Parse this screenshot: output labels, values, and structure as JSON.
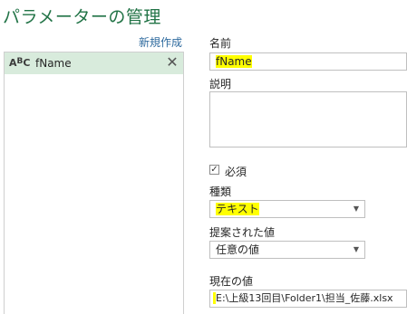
{
  "title": "パラメーターの管理",
  "new_link": "新規作成",
  "parameter_list": [
    {
      "name": "fName",
      "type_icon": "abc-text-type-icon"
    }
  ],
  "form": {
    "name_label": "名前",
    "name_value": "fName",
    "description_label": "説明",
    "description_value": "",
    "required_label": "必須",
    "required_checked": true,
    "type_label": "種類",
    "type_value": "テキスト",
    "suggested_label": "提案された値",
    "suggested_value": "任意の値",
    "current_label": "現在の値",
    "current_value": "E:\\上級13回目\\Folder1\\担当_佐藤.xlsx"
  },
  "colors": {
    "title": "#217346",
    "link": "#2e6a9e",
    "selected_item": "#d8ebdc",
    "highlight": "#ffff00"
  }
}
